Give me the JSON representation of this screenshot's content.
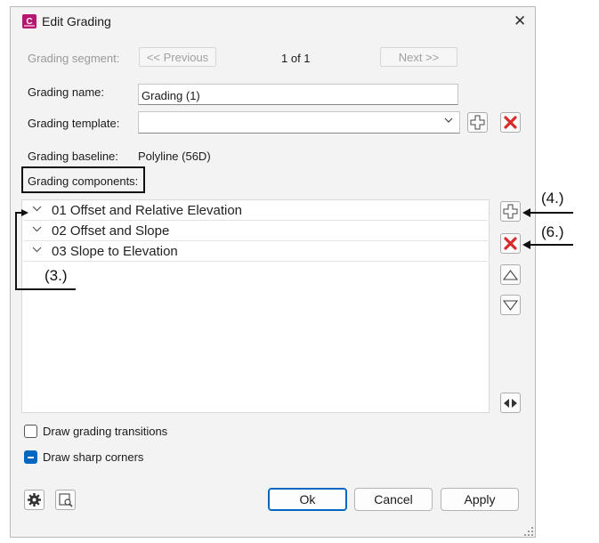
{
  "dialog": {
    "title": "Edit Grading",
    "close_glyph": "✕"
  },
  "segment": {
    "label": "Grading segment:",
    "previous": "<< Previous",
    "position": "1 of 1",
    "next": "Next >>"
  },
  "name": {
    "label": "Grading name:",
    "value": "Grading (1)"
  },
  "template": {
    "label": "Grading template:",
    "value": ""
  },
  "baseline": {
    "label": "Grading baseline:",
    "value": "Polyline (56D)"
  },
  "components": {
    "label": "Grading components:",
    "items": [
      {
        "label": "01 Offset and Relative Elevation"
      },
      {
        "label": "02 Offset and Slope"
      },
      {
        "label": "03 Slope to Elevation"
      }
    ]
  },
  "options": {
    "transitions_label": "Draw grading transitions",
    "transitions_checked": false,
    "sharp_corners_label": "Draw sharp corners",
    "sharp_corners_checked": true
  },
  "footer": {
    "ok": "Ok",
    "cancel": "Cancel",
    "apply": "Apply"
  },
  "annotations": {
    "callout_3": "(3.)",
    "callout_4": "(4.)",
    "callout_6": "(6.)"
  },
  "colors": {
    "accent": "#0067c0",
    "delete_red": "#d92b2b",
    "app_icon": "#b5166f"
  },
  "icons": {
    "app": "civil3d-app-icon",
    "add": "plus-icon",
    "delete": "red-x-icon",
    "up": "triangle-up-icon",
    "down": "triangle-down-icon",
    "swap": "left-right-arrows-icon",
    "settings": "gear-icon",
    "zoom": "zoom-to-icon"
  }
}
